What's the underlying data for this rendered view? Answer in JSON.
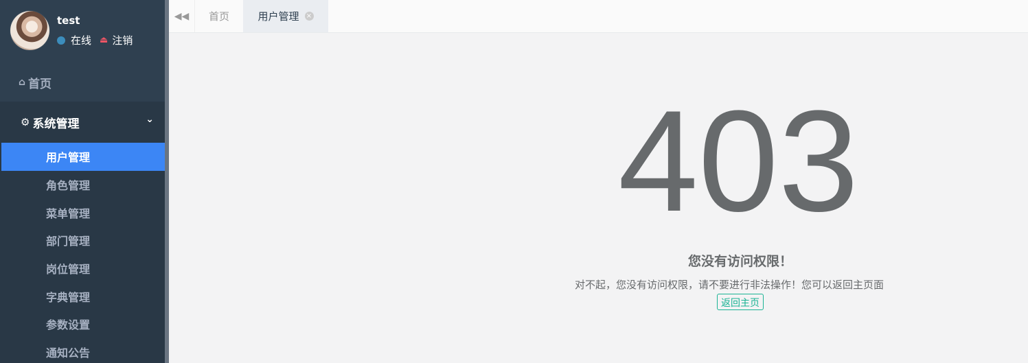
{
  "user": {
    "name": "test",
    "status": "在线",
    "logout": "注销"
  },
  "sidebar": {
    "home": "首页",
    "group": "系统管理",
    "items": [
      {
        "label": "用户管理",
        "active": true
      },
      {
        "label": "角色管理"
      },
      {
        "label": "菜单管理"
      },
      {
        "label": "部门管理"
      },
      {
        "label": "岗位管理"
      },
      {
        "label": "字典管理"
      },
      {
        "label": "参数设置"
      },
      {
        "label": "通知公告"
      }
    ]
  },
  "tabs": [
    {
      "label": "首页"
    },
    {
      "label": "用户管理",
      "active": true
    }
  ],
  "error": {
    "code": "403",
    "title": "您没有访问权限！",
    "description": "对不起，您没有访问权限，请不要进行非法操作！您可以返回主页面",
    "button": "返回主页"
  },
  "colors": {
    "sidebar_bg": "#2f4050",
    "active_item": "#3c86f5",
    "button_accent": "#1ab394",
    "online_dot": "#3c8dbc",
    "logout_icon": "#ed5565"
  },
  "icons": {
    "home": "home-icon",
    "settings": "gear-icon",
    "chevron": "chevron-down-icon",
    "logout": "logout-icon",
    "back": "double-left-arrow-icon",
    "close": "close-circle-icon"
  }
}
